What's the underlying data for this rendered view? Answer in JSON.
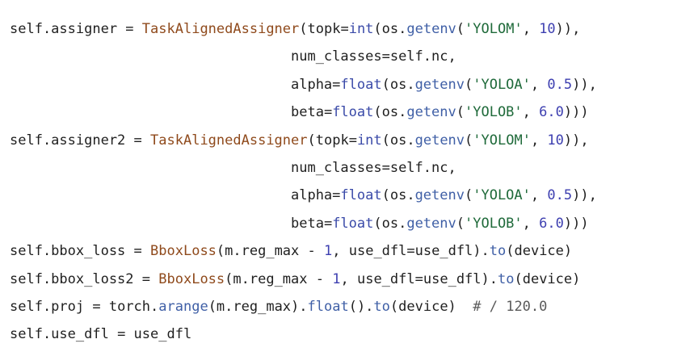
{
  "colors": {
    "background": "#ffffff",
    "text": "#1f1f1f",
    "class_name": "#8f4a1c",
    "builtin": "#3a4aa8",
    "method": "#3f5fa6",
    "string": "#1f6a3a",
    "number": "#3d3fb0",
    "comment": "#5a5a5a"
  },
  "lines": [
    [
      {
        "t": "plain",
        "v": "self.assigner "
      },
      {
        "t": "op",
        "v": "="
      },
      {
        "t": "plain",
        "v": " "
      },
      {
        "t": "class",
        "v": "TaskAlignedAssigner"
      },
      {
        "t": "plain",
        "v": "(topk"
      },
      {
        "t": "op",
        "v": "="
      },
      {
        "t": "builtin",
        "v": "int"
      },
      {
        "t": "plain",
        "v": "(os."
      },
      {
        "t": "func",
        "v": "getenv"
      },
      {
        "t": "plain",
        "v": "("
      },
      {
        "t": "string",
        "v": "'YOLOM'"
      },
      {
        "t": "plain",
        "v": ", "
      },
      {
        "t": "number",
        "v": "10"
      },
      {
        "t": "plain",
        "v": ")),"
      }
    ],
    [
      {
        "t": "plain",
        "v": "                                  num_classes"
      },
      {
        "t": "op",
        "v": "="
      },
      {
        "t": "plain",
        "v": "self.nc,"
      }
    ],
    [
      {
        "t": "plain",
        "v": "                                  alpha"
      },
      {
        "t": "op",
        "v": "="
      },
      {
        "t": "builtin",
        "v": "float"
      },
      {
        "t": "plain",
        "v": "(os."
      },
      {
        "t": "func",
        "v": "getenv"
      },
      {
        "t": "plain",
        "v": "("
      },
      {
        "t": "string",
        "v": "'YOLOA'"
      },
      {
        "t": "plain",
        "v": ", "
      },
      {
        "t": "number",
        "v": "0.5"
      },
      {
        "t": "plain",
        "v": ")),"
      }
    ],
    [
      {
        "t": "plain",
        "v": "                                  beta"
      },
      {
        "t": "op",
        "v": "="
      },
      {
        "t": "builtin",
        "v": "float"
      },
      {
        "t": "plain",
        "v": "(os."
      },
      {
        "t": "func",
        "v": "getenv"
      },
      {
        "t": "plain",
        "v": "("
      },
      {
        "t": "string",
        "v": "'YOLOB'"
      },
      {
        "t": "plain",
        "v": ", "
      },
      {
        "t": "number",
        "v": "6.0"
      },
      {
        "t": "plain",
        "v": ")))"
      }
    ],
    [
      {
        "t": "plain",
        "v": "self.assigner2 "
      },
      {
        "t": "op",
        "v": "="
      },
      {
        "t": "plain",
        "v": " "
      },
      {
        "t": "class",
        "v": "TaskAlignedAssigner"
      },
      {
        "t": "plain",
        "v": "(topk"
      },
      {
        "t": "op",
        "v": "="
      },
      {
        "t": "builtin",
        "v": "int"
      },
      {
        "t": "plain",
        "v": "(os."
      },
      {
        "t": "func",
        "v": "getenv"
      },
      {
        "t": "plain",
        "v": "("
      },
      {
        "t": "string",
        "v": "'YOLOM'"
      },
      {
        "t": "plain",
        "v": ", "
      },
      {
        "t": "number",
        "v": "10"
      },
      {
        "t": "plain",
        "v": ")),"
      }
    ],
    [
      {
        "t": "plain",
        "v": "                                  num_classes"
      },
      {
        "t": "op",
        "v": "="
      },
      {
        "t": "plain",
        "v": "self.nc,"
      }
    ],
    [
      {
        "t": "plain",
        "v": "                                  alpha"
      },
      {
        "t": "op",
        "v": "="
      },
      {
        "t": "builtin",
        "v": "float"
      },
      {
        "t": "plain",
        "v": "(os."
      },
      {
        "t": "func",
        "v": "getenv"
      },
      {
        "t": "plain",
        "v": "("
      },
      {
        "t": "string",
        "v": "'YOLOA'"
      },
      {
        "t": "plain",
        "v": ", "
      },
      {
        "t": "number",
        "v": "0.5"
      },
      {
        "t": "plain",
        "v": ")),"
      }
    ],
    [
      {
        "t": "plain",
        "v": "                                  beta"
      },
      {
        "t": "op",
        "v": "="
      },
      {
        "t": "builtin",
        "v": "float"
      },
      {
        "t": "plain",
        "v": "(os."
      },
      {
        "t": "func",
        "v": "getenv"
      },
      {
        "t": "plain",
        "v": "("
      },
      {
        "t": "string",
        "v": "'YOLOB'"
      },
      {
        "t": "plain",
        "v": ", "
      },
      {
        "t": "number",
        "v": "6.0"
      },
      {
        "t": "plain",
        "v": ")))"
      }
    ],
    [
      {
        "t": "plain",
        "v": "self.bbox_loss "
      },
      {
        "t": "op",
        "v": "="
      },
      {
        "t": "plain",
        "v": " "
      },
      {
        "t": "class",
        "v": "BboxLoss"
      },
      {
        "t": "plain",
        "v": "(m.reg_max "
      },
      {
        "t": "op",
        "v": "-"
      },
      {
        "t": "plain",
        "v": " "
      },
      {
        "t": "number",
        "v": "1"
      },
      {
        "t": "plain",
        "v": ", use_dfl"
      },
      {
        "t": "op",
        "v": "="
      },
      {
        "t": "plain",
        "v": "use_dfl)."
      },
      {
        "t": "func",
        "v": "to"
      },
      {
        "t": "plain",
        "v": "(device)"
      }
    ],
    [
      {
        "t": "plain",
        "v": "self.bbox_loss2 "
      },
      {
        "t": "op",
        "v": "="
      },
      {
        "t": "plain",
        "v": " "
      },
      {
        "t": "class",
        "v": "BboxLoss"
      },
      {
        "t": "plain",
        "v": "(m.reg_max "
      },
      {
        "t": "op",
        "v": "-"
      },
      {
        "t": "plain",
        "v": " "
      },
      {
        "t": "number",
        "v": "1"
      },
      {
        "t": "plain",
        "v": ", use_dfl"
      },
      {
        "t": "op",
        "v": "="
      },
      {
        "t": "plain",
        "v": "use_dfl)."
      },
      {
        "t": "func",
        "v": "to"
      },
      {
        "t": "plain",
        "v": "(device)"
      }
    ],
    [
      {
        "t": "plain",
        "v": "self.proj "
      },
      {
        "t": "op",
        "v": "="
      },
      {
        "t": "plain",
        "v": " torch."
      },
      {
        "t": "func",
        "v": "arange"
      },
      {
        "t": "plain",
        "v": "(m.reg_max)."
      },
      {
        "t": "func",
        "v": "float"
      },
      {
        "t": "plain",
        "v": "()."
      },
      {
        "t": "func",
        "v": "to"
      },
      {
        "t": "plain",
        "v": "(device)  "
      },
      {
        "t": "comment",
        "v": "# / 120.0"
      }
    ],
    [
      {
        "t": "plain",
        "v": "self.use_dfl "
      },
      {
        "t": "op",
        "v": "="
      },
      {
        "t": "plain",
        "v": " use_dfl"
      }
    ]
  ]
}
